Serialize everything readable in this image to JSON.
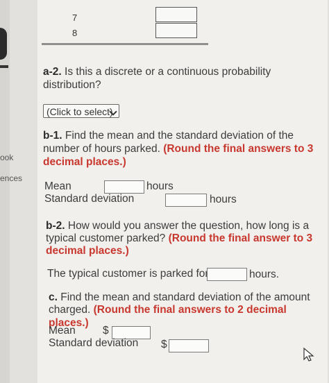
{
  "sidebar": {
    "partial_label_1": "ook",
    "partial_label_2": "ences"
  },
  "table": {
    "rows": [
      {
        "label": "7"
      },
      {
        "label": "8"
      }
    ]
  },
  "q_a2": {
    "prefix": "a-2.",
    "text": " Is this a discrete or a continuous probability",
    "text2": "distribution?",
    "select_label": "(Click to select)"
  },
  "q_b1": {
    "prefix": "b-1.",
    "line1": " Find the mean and the standard deviation of the",
    "line2_plain": "number of hours parked. ",
    "line2_red": "(Round the final answers to 3",
    "line3_red": "decimal places.)",
    "mean_label": "Mean",
    "mean_unit": "hours",
    "std_label": "Standard deviation",
    "std_unit": "hours"
  },
  "q_b2": {
    "prefix": "b-2.",
    "line1": " How would you answer the question, how long is a",
    "line2_plain": "typical customer parked? ",
    "line2_red": "(Round the final answer to 3",
    "line3_red": "decimal places.)",
    "answer_label": "The typical customer is parked for",
    "answer_unit": "hours."
  },
  "q_c": {
    "prefix": "c.",
    "line1": " Find the mean and standard deviation of the amount",
    "line2_plain": "charged. ",
    "line2_red": "(Round the final answers to 2 decimal places.)",
    "mean_label": "Mean",
    "std_label": "Standard deviation",
    "currency": "$"
  }
}
